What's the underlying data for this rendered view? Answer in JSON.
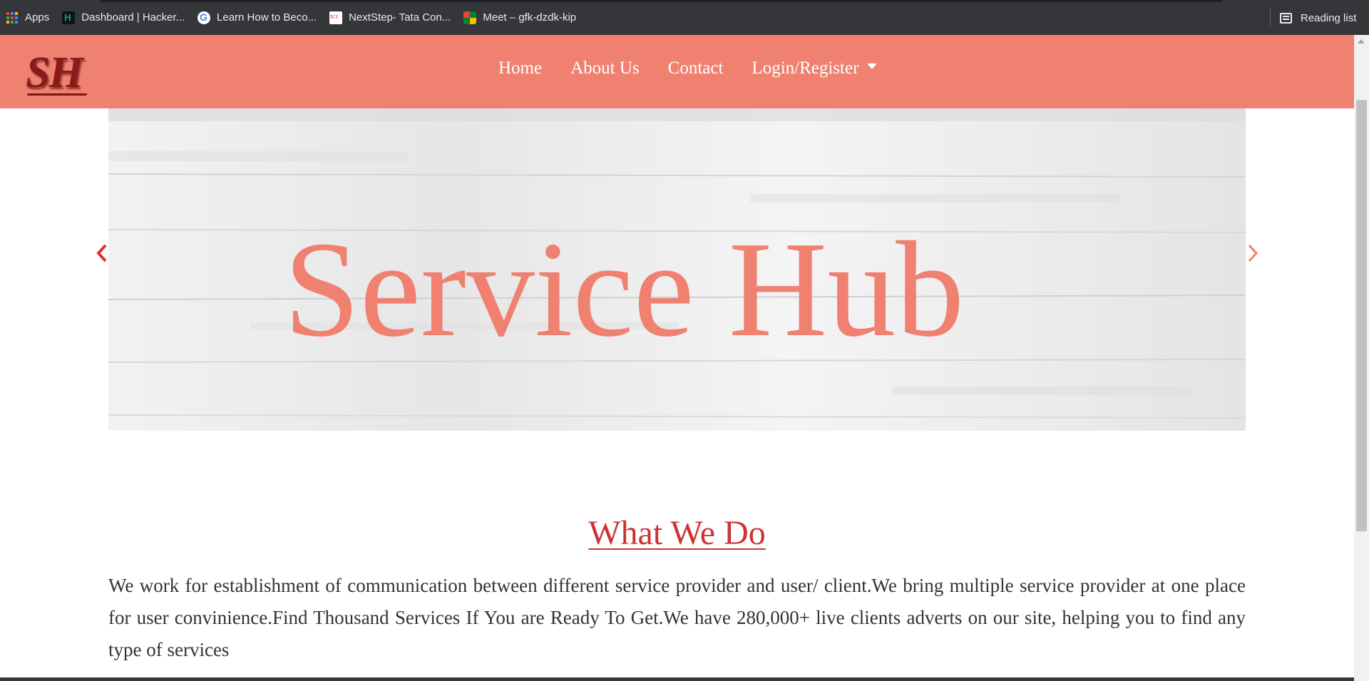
{
  "browser": {
    "bookmarks": [
      {
        "label": "Apps",
        "icon": "apps-grid-icon"
      },
      {
        "label": "Dashboard | Hacker...",
        "icon": "hackerrank-icon"
      },
      {
        "label": "Learn How to Beco...",
        "icon": "google-icon"
      },
      {
        "label": "NextStep- Tata Con...",
        "icon": "tcs-icon"
      },
      {
        "label": "Meet – gfk-dzdk-kip",
        "icon": "meet-icon"
      }
    ],
    "reading_list_label": "Reading list"
  },
  "site": {
    "logo_text": "SH",
    "nav": {
      "home": "Home",
      "about": "About Us",
      "contact": "Contact",
      "login": "Login/Register"
    },
    "carousel": {
      "title": "Service Hub",
      "prev_icon": "chevron-left-icon",
      "next_icon": "chevron-right-icon"
    },
    "what_we_do": {
      "title": "What We Do",
      "body": "We work for establishment of communication between different service provider and user/ client.We bring multiple service provider at one place for user convinience.Find Thousand Services If You are Ready To Get.We have 280,000+ live clients adverts on our site, helping you to find any type of services"
    }
  },
  "colors": {
    "brand": "#f08070",
    "heading_red": "#cc3333",
    "logo_dark_red": "#8b1a1a",
    "browser_bar": "#35363a"
  }
}
